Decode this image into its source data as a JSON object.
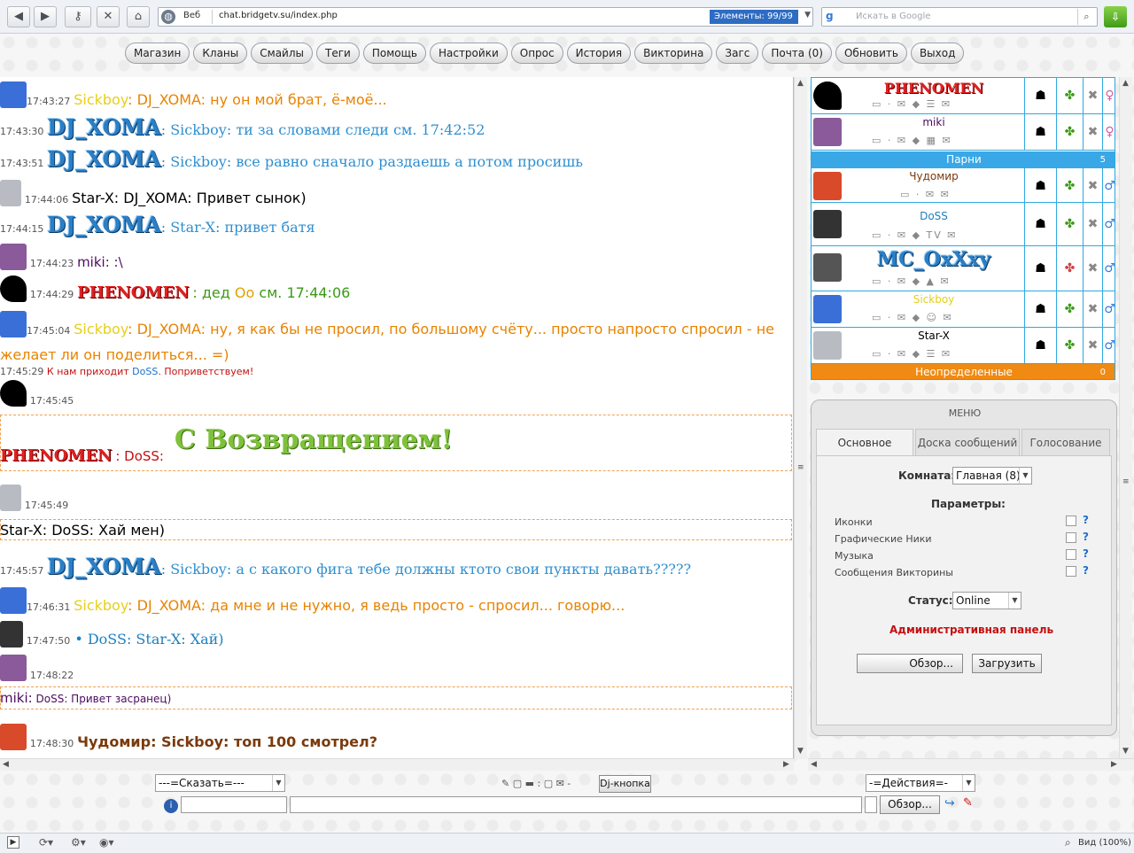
{
  "browser": {
    "web_label": "Веб",
    "url": "chat.bridgetv.su/index.php",
    "elements_badge": "Элементы:  99/99",
    "search_placeholder": "Искать в Google",
    "zoom_label": "Вид (100%)"
  },
  "nav": [
    "Магазин",
    "Кланы",
    "Смайлы",
    "Теги",
    "Помощь",
    "Настройки",
    "Опрос",
    "История",
    "Викторина",
    "Загс",
    "Почта (0)",
    "Обновить",
    "Выход"
  ],
  "chat": {
    "m1": {
      "time": "17:43:27",
      "name": "Sickboy",
      "text": ": DJ_XOMA: ну он мой брат, ё-моё..."
    },
    "m2": {
      "time": "17:43:30",
      "nick": "DJ_XOMA",
      "text": "Sickboy: ти за словами следи см. 17:42:52"
    },
    "m3": {
      "time": "17:43:51",
      "nick": "DJ_XOMA",
      "text": "Sickboy: все равно сначало раздаешь а потом просишь"
    },
    "m4": {
      "time": "17:44:06",
      "text": "Star-X: DJ_XOMA: Привет сынок)"
    },
    "m5": {
      "time": "17:44:15",
      "nick": "DJ_XOMA",
      "text": "Star-X: привет батя"
    },
    "m6": {
      "time": "17:44:23",
      "text": "miki: :\\"
    },
    "m7": {
      "time": "17:44:29",
      "nick": "PHENOMEN",
      "text": ": дед ",
      "text2": "Оо",
      "text3": " см. 17:44:06"
    },
    "m8": {
      "time": "17:45:04",
      "name": "Sickboy",
      "text": ": DJ_XOMA: ну, я как бы не просил, по большому счёту... просто напросто спросил - не",
      "text_line2": "желает ли он поделиться... =)"
    },
    "sys1": {
      "time": "17:45:29",
      "pre": " К нам приходит ",
      "name": "DoSS",
      "post": ". Поприветствуем!"
    },
    "m9": {
      "time": "17:45:45",
      "nick": "PHENOMEN",
      "to": " : DoSS:",
      "banner": "С Возвращением!"
    },
    "m10": {
      "time": "17:45:49",
      "text": "Star-X: DoSS: Хай мен)"
    },
    "m11": {
      "time": "17:45:57",
      "nick": "DJ_XOMA",
      "text": "Sickboy: а с какого фига тебе должны ктото свои пункты давать?????"
    },
    "m12": {
      "time": "17:46:31",
      "name": "Sickboy",
      "text": ": DJ_XOMA: да мне и не нужно, я ведь просто - спросил... говорю..."
    },
    "m13": {
      "time": "17:47:50",
      "text": " • DoSS: Star-X: Хай)"
    },
    "m14": {
      "time": "17:48:22",
      "name": "miki:",
      "text": " DoSS: Привет засранец)"
    },
    "m15": {
      "time": "17:48:30",
      "text": "Чудомир: Sickboy: топ 100 смотрел?"
    }
  },
  "users": {
    "top1": "PHENOMEN",
    "top2": "miki",
    "group_boys": "Парни",
    "group_boys_count": "5",
    "u1": "Чудомир",
    "u2": "DoSS",
    "u3": "MC_OxXxy",
    "u4": "Sickboy",
    "u5": "Star-X",
    "group_undef": "Неопределенные",
    "group_undef_count": "0"
  },
  "menu": {
    "title": "МЕНЮ",
    "tabs": [
      "Основное",
      "Доска сообщений",
      "Голосование"
    ],
    "room_label": "Комната:",
    "room_value": "Главная (8)",
    "params_label": "Параметры:",
    "params": [
      "Иконки",
      "Графические Ники",
      "Музыка",
      "Сообщения Викторины"
    ],
    "status_label": "Статус:",
    "status_value": "Online",
    "admin": "Административная панель",
    "browse": "Обзор...",
    "upload": "Загрузить"
  },
  "bottom": {
    "say": "---=Сказать=---",
    "dj": "Dj-кнопка",
    "actions": "-=Действия=-",
    "browse": "Обзор..."
  },
  "colors": {
    "accent": "#2eaae0",
    "boys": "#3aa7e6",
    "undef": "#f08a12",
    "admin": "#c41010"
  }
}
